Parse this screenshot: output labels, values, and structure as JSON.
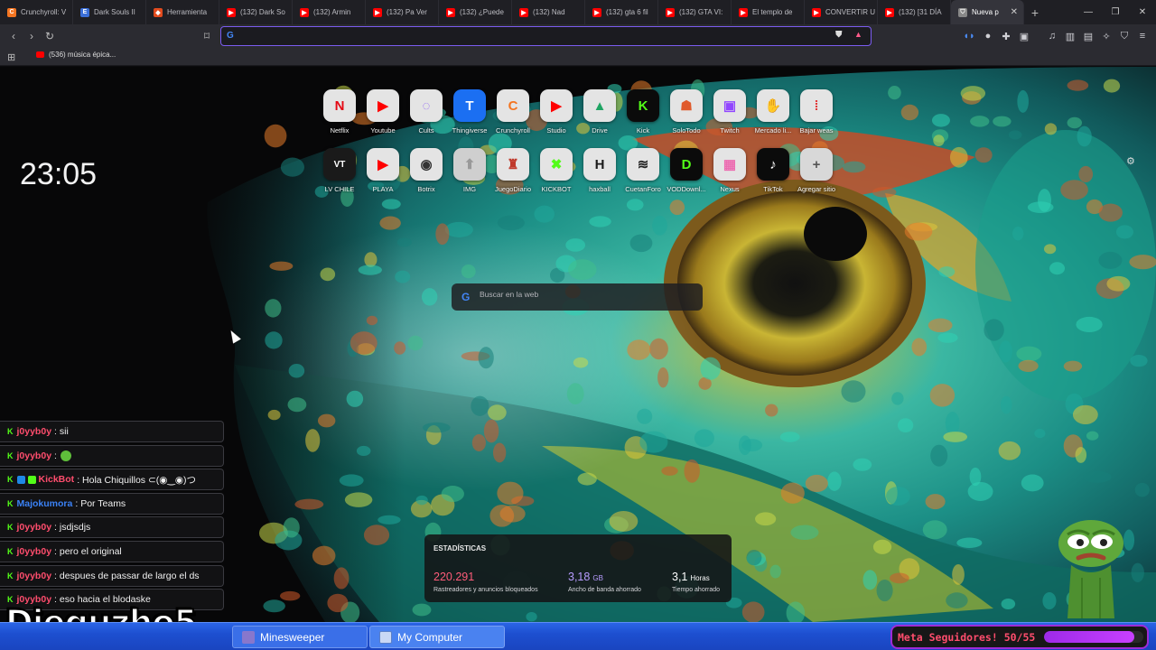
{
  "tabs": [
    {
      "title": "Crunchyroll: V",
      "icon": "crunchyroll-icon",
      "color": "#f47521"
    },
    {
      "title": "Dark Souls II",
      "icon": "e-icon",
      "color": "#3b6fd8"
    },
    {
      "title": "Herramienta",
      "icon": "tool-icon",
      "color": "#e24b1e"
    },
    {
      "title": "(132) Dark So",
      "icon": "youtube-icon",
      "color": "#ff0000"
    },
    {
      "title": "(132) Armin",
      "icon": "youtube-icon",
      "color": "#ff0000"
    },
    {
      "title": "(132) Pa Ver",
      "icon": "youtube-icon",
      "color": "#ff0000"
    },
    {
      "title": "(132) ¿Puede",
      "icon": "youtube-icon",
      "color": "#ff0000"
    },
    {
      "title": "(132) Nad",
      "icon": "youtube-icon",
      "color": "#ff0000"
    },
    {
      "title": "(132) gta 6 fil",
      "icon": "youtube-icon",
      "color": "#ff0000"
    },
    {
      "title": "(132) GTA VI:",
      "icon": "youtube-icon",
      "color": "#ff0000"
    },
    {
      "title": "El templo de",
      "icon": "youtube-icon",
      "color": "#ff0000"
    },
    {
      "title": "CONVERTIR U",
      "icon": "youtube-icon",
      "color": "#ff0000"
    },
    {
      "title": "(132) [31 DÍA",
      "icon": "youtube-icon",
      "color": "#ff0000"
    },
    {
      "title": "Nueva p",
      "icon": "shield-icon",
      "color": "#888888",
      "active": true
    }
  ],
  "omnibox": {
    "value": "",
    "placeholder": ""
  },
  "bookmark": {
    "label": "(536) música épica..."
  },
  "clock": "23:05",
  "dial_row1": [
    {
      "label": "Netflix",
      "glyph": "N",
      "bg": "#e4e4e4",
      "fg": "#e50914"
    },
    {
      "label": "Youtube",
      "glyph": "▶",
      "bg": "#e4e4e4",
      "fg": "#ff0000"
    },
    {
      "label": "Cults",
      "glyph": "◌",
      "bg": "#e4e4e4",
      "fg": "#8b5cf6"
    },
    {
      "label": "Thingiverse",
      "glyph": "T",
      "bg": "#1b6ff2",
      "fg": "#ffffff"
    },
    {
      "label": "Crunchyroll",
      "glyph": "C",
      "bg": "#e4e4e4",
      "fg": "#f47521"
    },
    {
      "label": "Studio",
      "glyph": "▶",
      "bg": "#e4e4e4",
      "fg": "#ff0000"
    },
    {
      "label": "Drive",
      "glyph": "▲",
      "bg": "#e4e4e4",
      "fg": "#1fa463"
    },
    {
      "label": "Kick",
      "glyph": "K",
      "bg": "#0b0b0b",
      "fg": "#53fc18"
    },
    {
      "label": "SoloTodo",
      "glyph": "☗",
      "bg": "#e4e4e4",
      "fg": "#e05a2b"
    },
    {
      "label": "Twitch",
      "glyph": "▣",
      "bg": "#e4e4e4",
      "fg": "#9146ff"
    },
    {
      "label": "Mercado li...",
      "glyph": "✋",
      "bg": "#e4e4e4",
      "fg": "#d4a90e"
    },
    {
      "label": "Bajar weas",
      "glyph": "⁞",
      "bg": "#e4e4e4",
      "fg": "#e03a3a"
    }
  ],
  "dial_row2": [
    {
      "label": "LV CHILE",
      "glyph": "VT",
      "bg": "#1a1a1a",
      "fg": "#ffffff"
    },
    {
      "label": "PLAYA",
      "glyph": "▶",
      "bg": "#e4e4e4",
      "fg": "#ff0000"
    },
    {
      "label": "Botrix",
      "glyph": "◉",
      "bg": "#e4e4e4",
      "fg": "#333333"
    },
    {
      "label": "IMG",
      "glyph": "⬆",
      "bg": "#cfcfcf",
      "fg": "#999999"
    },
    {
      "label": "JuegoDiario",
      "glyph": "♜",
      "bg": "#e4e4e4",
      "fg": "#c0392b"
    },
    {
      "label": "KICKBOT",
      "glyph": "✖",
      "bg": "#e4e4e4",
      "fg": "#53fc18"
    },
    {
      "label": "haxball",
      "glyph": "H",
      "bg": "#e4e4e4",
      "fg": "#1a1a1a"
    },
    {
      "label": "CuetanForo",
      "glyph": "≋",
      "bg": "#e4e4e4",
      "fg": "#222222"
    },
    {
      "label": "VODDownl...",
      "glyph": "D",
      "bg": "#0b0b0b",
      "fg": "#53fc18"
    },
    {
      "label": "Nexus",
      "glyph": "▦",
      "bg": "#e4e4e4",
      "fg": "#ec6ab0"
    },
    {
      "label": "TikTok",
      "glyph": "♪",
      "bg": "#0b0b0b",
      "fg": "#ffffff"
    },
    {
      "label": "Agregar sitio",
      "glyph": "+",
      "bg": "#d8d8d8",
      "fg": "#555555"
    }
  ],
  "websearch": {
    "placeholder": "Buscar en la web"
  },
  "chat": [
    {
      "user": "j0yyb0y",
      "color": "#ff4d6d",
      "msg": ": sii",
      "badges": []
    },
    {
      "user": "j0yyb0y",
      "color": "#ff4d6d",
      "msg": ": ",
      "emote": true,
      "badges": []
    },
    {
      "user": "KickBot",
      "color": "#ff4d6d",
      "msg": ": Hola Chiquillos ⊂(◉‿◉)つ",
      "badges": [
        "#1e88e5",
        "#53fc18"
      ]
    },
    {
      "user": "Majokumora",
      "color": "#3b82f6",
      "msg": ": Por Teams",
      "badges": []
    },
    {
      "user": "j0yyb0y",
      "color": "#ff4d6d",
      "msg": ": jsdjsdjs",
      "badges": []
    },
    {
      "user": "j0yyb0y",
      "color": "#ff4d6d",
      "msg": ": pero el original",
      "badges": []
    },
    {
      "user": "j0yyb0y",
      "color": "#ff4d6d",
      "msg": ": despues de passar de largo el ds",
      "badges": []
    },
    {
      "user": "j0yyb0y",
      "color": "#ff4d6d",
      "msg": ": eso hacia el blodaske",
      "badges": []
    }
  ],
  "streamer_name": "Dieguzho5",
  "stats": {
    "title": "ESTADÍSTICAS",
    "items": [
      {
        "value": "220.291",
        "unit": "",
        "desc": "Rastreadores y anuncios bloqueados",
        "color": "#ff5c7a"
      },
      {
        "value": "3,18",
        "unit": "GB",
        "desc": "Ancho de banda ahorrado",
        "color": "#b79cff"
      },
      {
        "value": "3,1",
        "unit": "Horas",
        "desc": "Tiempo ahorrado",
        "color": "#ffffff"
      }
    ]
  },
  "taskbar": {
    "items": [
      {
        "label": "Minesweeper",
        "icon": "minesweeper-icon"
      },
      {
        "label": "My Computer",
        "icon": "computer-icon"
      }
    ]
  },
  "goal": {
    "label": "Meta Seguidores! 50/55",
    "progress": 0.909
  }
}
